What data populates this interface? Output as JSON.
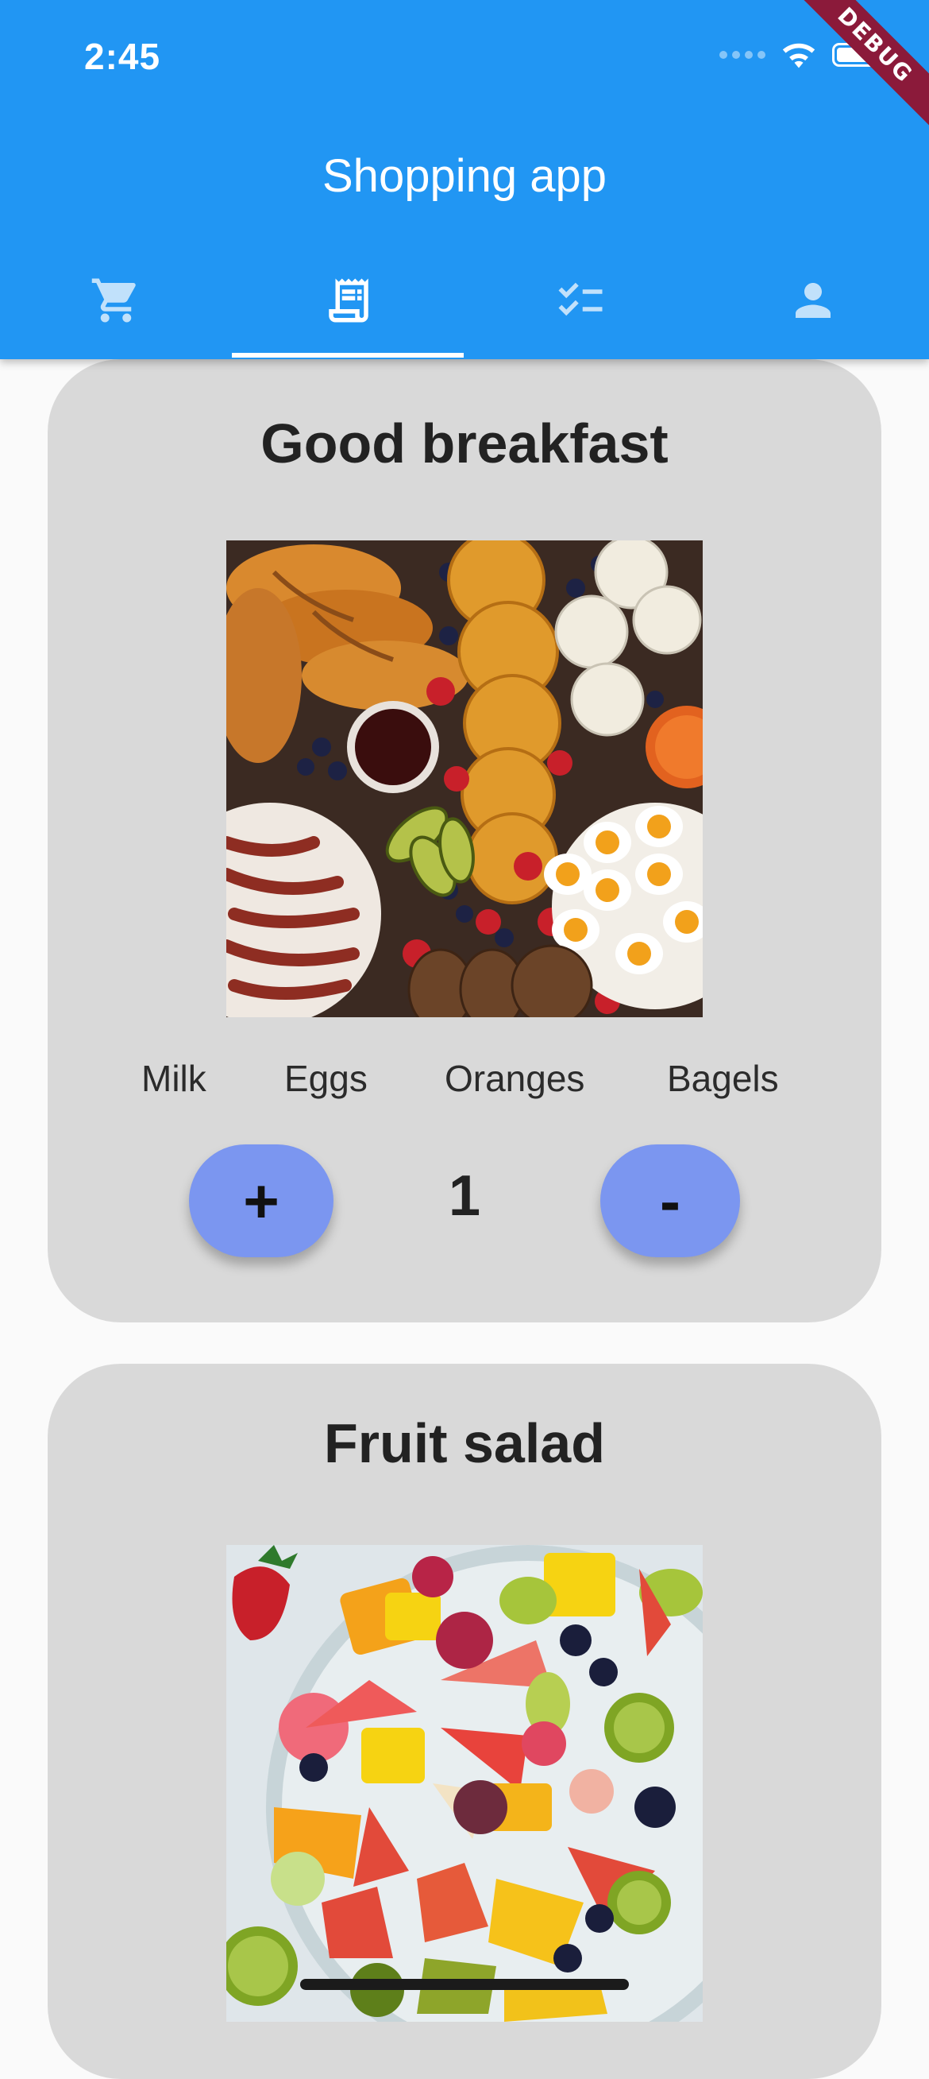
{
  "status_bar": {
    "time": "2:45"
  },
  "debug_banner": "DEBUG",
  "app_bar": {
    "title": "Shopping app",
    "background": "#2196f3",
    "tabs": [
      {
        "icon": "cart-icon",
        "selected": false
      },
      {
        "icon": "receipt-icon",
        "selected": true
      },
      {
        "icon": "checklist-icon",
        "selected": false
      },
      {
        "icon": "person-icon",
        "selected": false
      }
    ]
  },
  "recipes": [
    {
      "title": "Good breakfast",
      "image": "breakfast-platter-photo",
      "ingredients": [
        "Milk",
        "Eggs",
        "Oranges",
        "Bagels"
      ],
      "quantity": "1",
      "plus_label": "+",
      "minus_label": "-"
    },
    {
      "title": "Fruit salad",
      "image": "fruit-salad-photo"
    }
  ],
  "colors": {
    "card_background": "#d9d9d9",
    "button_background": "#7b96f0"
  }
}
